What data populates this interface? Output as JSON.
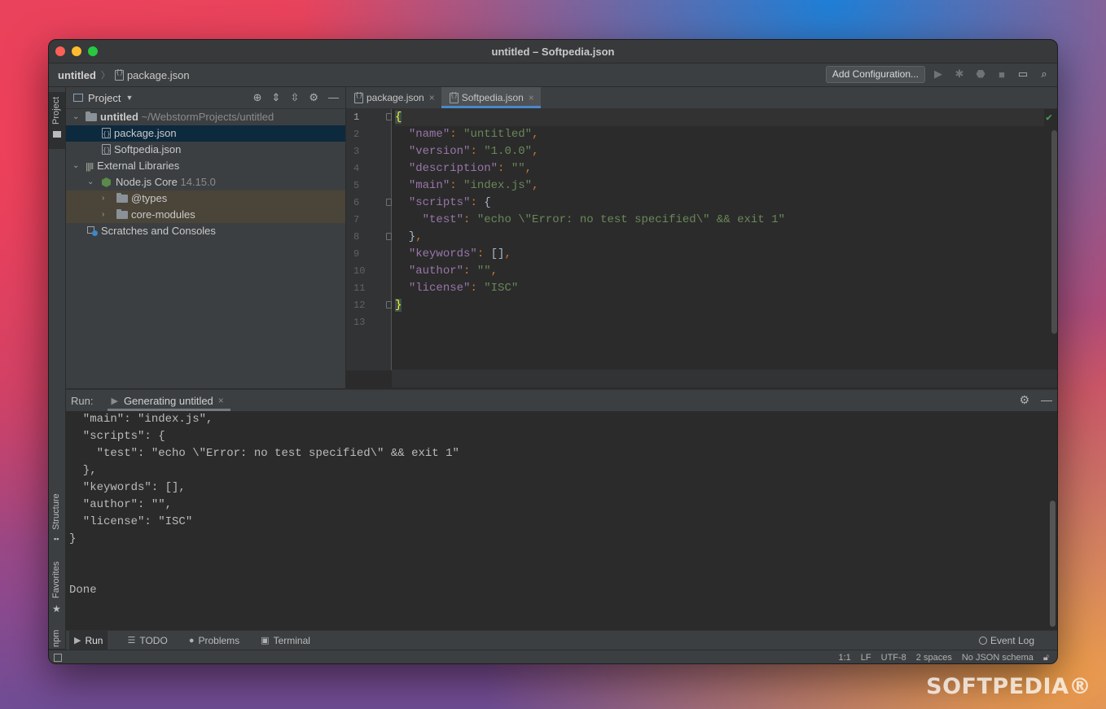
{
  "window": {
    "title": "untitled – Softpedia.json"
  },
  "navbar": {
    "root": "untitled",
    "file": "package.json",
    "add_config": "Add Configuration..."
  },
  "left_strip": {
    "project": "Project",
    "structure": "Structure",
    "favorites": "Favorites",
    "npm": "npm"
  },
  "project": {
    "header": "Project",
    "tree": {
      "root_name": "untitled",
      "root_path": "~/WebstormProjects/untitled",
      "file1": "package.json",
      "file2": "Softpedia.json",
      "ext_libs": "External Libraries",
      "node_core": "Node.js Core",
      "node_version": "14.15.0",
      "types": "@types",
      "core_modules": "core-modules",
      "scratches": "Scratches and Consoles"
    }
  },
  "editor": {
    "tabs": [
      "package.json",
      "Softpedia.json"
    ],
    "line_numbers": [
      "1",
      "2",
      "3",
      "4",
      "5",
      "6",
      "7",
      "8",
      "9",
      "10",
      "11",
      "12",
      "13"
    ],
    "lines": [
      {
        "k": "",
        "v": ""
      },
      {
        "k": "\"name\"",
        "v": "\"untitled\""
      },
      {
        "k": "\"version\"",
        "v": "\"1.0.0\""
      },
      {
        "k": "\"description\"",
        "v": "\"\""
      },
      {
        "k": "\"main\"",
        "v": "\"index.js\""
      },
      {
        "k": "\"scripts\"",
        "v": ""
      },
      {
        "k": "\"test\"",
        "v": "\"echo \\\"Error: no test specified\\\" && exit 1\""
      },
      {
        "k": "",
        "v": ""
      },
      {
        "k": "\"keywords\"",
        "v": ""
      },
      {
        "k": "\"author\"",
        "v": "\"\""
      },
      {
        "k": "\"license\"",
        "v": "\"ISC\""
      }
    ]
  },
  "run": {
    "label": "Run:",
    "tab": "Generating untitled",
    "console": [
      "  \"main\": \"index.js\",",
      "  \"scripts\": {",
      "    \"test\": \"echo \\\"Error: no test specified\\\" && exit 1\"",
      "  },",
      "  \"keywords\": [],",
      "  \"author\": \"\",",
      "  \"license\": \"ISC\"",
      "}",
      "",
      "",
      "Done"
    ]
  },
  "toolbar_bottom": {
    "run": "Run",
    "todo": "TODO",
    "problems": "Problems",
    "terminal": "Terminal",
    "event_log": "Event Log"
  },
  "status": {
    "position": "1:1",
    "line_sep": "LF",
    "encoding": "UTF-8",
    "indent": "2 spaces",
    "schema": "No JSON schema"
  },
  "watermark": "SOFTPEDIA®"
}
